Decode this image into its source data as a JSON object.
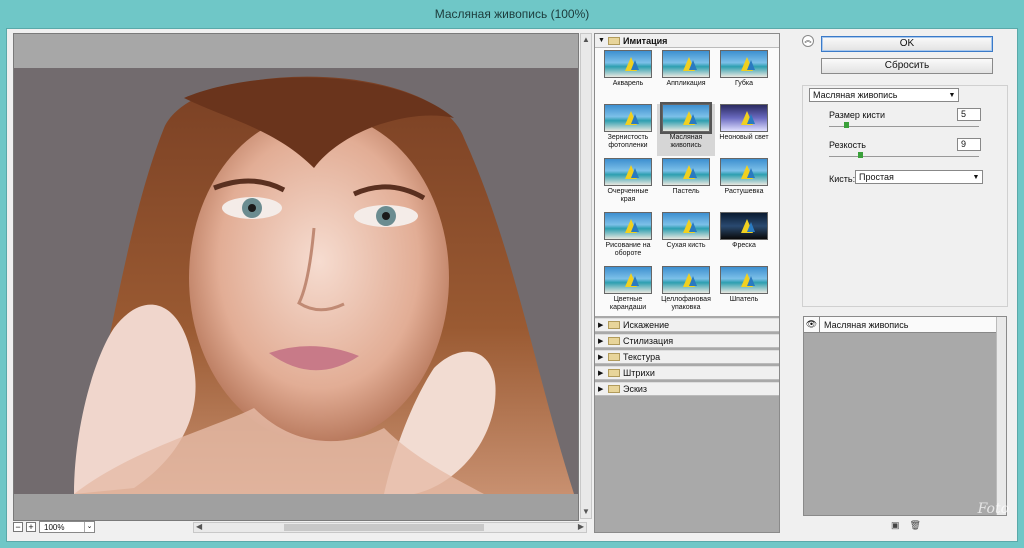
{
  "window": {
    "title": "Масляная живопись (100%)"
  },
  "preview": {
    "zoom": "100%",
    "zoom_out": "−",
    "zoom_in": "+",
    "dropdown": "⌄"
  },
  "gallery": {
    "open_category": "Имитация",
    "filters": [
      {
        "label": "Акварель"
      },
      {
        "label": "Аппликация"
      },
      {
        "label": "Губка"
      },
      {
        "label": "Зернистость фотопленки"
      },
      {
        "label": "Масляная живопись"
      },
      {
        "label": "Неоновый свет"
      },
      {
        "label": "Очерченные края"
      },
      {
        "label": "Пастель"
      },
      {
        "label": "Растушевка"
      },
      {
        "label": "Рисование на обороте"
      },
      {
        "label": "Сухая кисть"
      },
      {
        "label": "Фреска"
      },
      {
        "label": "Цветные карандаши"
      },
      {
        "label": "Целлофановая упаковка"
      },
      {
        "label": "Шпатель"
      }
    ],
    "selected_filter": "Масляная живопись",
    "categories": [
      "Искажение",
      "Стилизация",
      "Текстура",
      "Штрихи",
      "Эскиз"
    ]
  },
  "actions": {
    "ok": "OK",
    "reset": "Сбросить"
  },
  "settings": {
    "filter_select": "Масляная живопись",
    "brush_size_label": "Размер кисти",
    "brush_size": "5",
    "brush_size_fraction": 0.1,
    "sharpness_label": "Резкость",
    "sharpness": "9",
    "sharpness_fraction": 0.2,
    "brush_label": "Кисть:",
    "brush_value": "Простая"
  },
  "layers": {
    "items": [
      "Масляная живопись"
    ]
  },
  "watermark": "Foto"
}
